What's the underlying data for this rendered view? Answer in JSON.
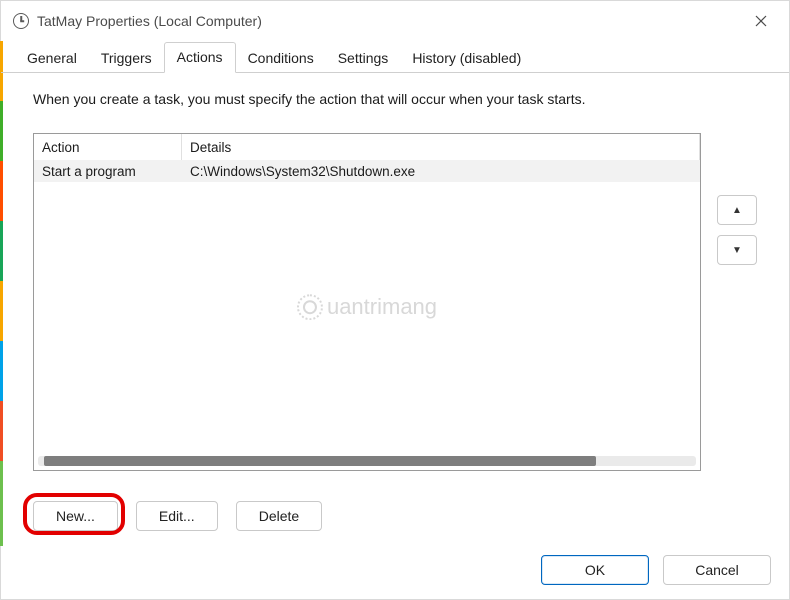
{
  "window": {
    "title": "TatMay Properties (Local Computer)"
  },
  "tabs": {
    "general": "General",
    "triggers": "Triggers",
    "actions": "Actions",
    "conditions": "Conditions",
    "settings": "Settings",
    "history": "History (disabled)",
    "active": "actions"
  },
  "instruction": "When you create a task, you must specify the action that will occur when your task starts.",
  "table": {
    "headers": {
      "action": "Action",
      "details": "Details"
    },
    "rows": [
      {
        "action": "Start a program",
        "details": "C:\\Windows\\System32\\Shutdown.exe"
      }
    ]
  },
  "buttons": {
    "new": "New...",
    "edit": "Edit...",
    "delete": "Delete",
    "ok": "OK",
    "cancel": "Cancel"
  },
  "watermark": "uantrimang"
}
